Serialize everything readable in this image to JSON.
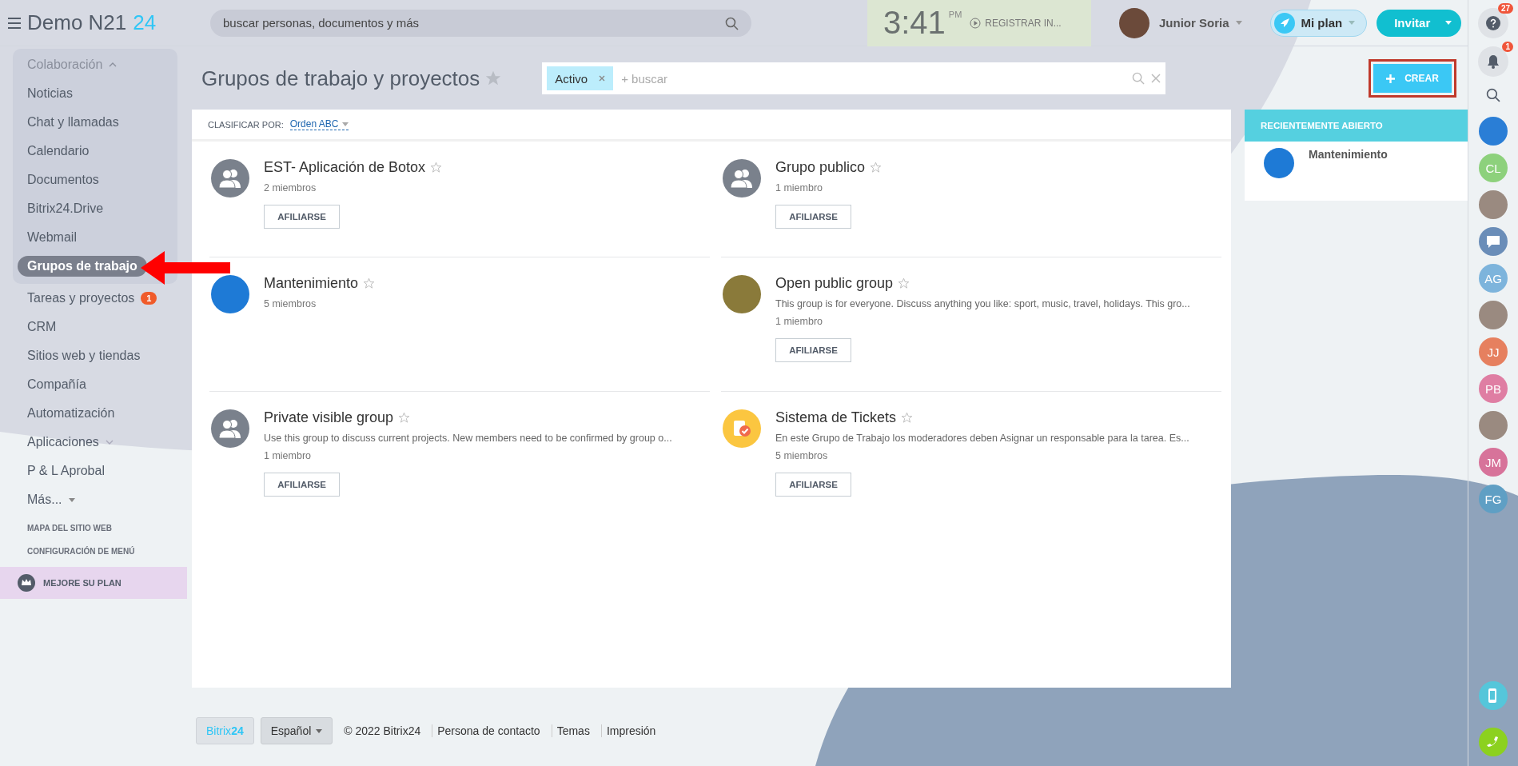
{
  "logo": {
    "name": "Demo N21",
    "suffix": "24"
  },
  "search": {
    "placeholder": "buscar personas, documentos y más"
  },
  "clock": {
    "time": "3:41",
    "period": "PM",
    "action": "REGISTRAR IN..."
  },
  "user": {
    "name": "Junior Soria"
  },
  "plan_button": "Mi plan",
  "invite_button": "Invitar",
  "sidebar": {
    "group": {
      "label": "Colaboración",
      "expanded": true,
      "items": [
        {
          "label": "Noticias",
          "selected": false
        },
        {
          "label": "Chat y llamadas",
          "selected": false
        },
        {
          "label": "Calendario",
          "selected": false
        },
        {
          "label": "Documentos",
          "selected": false
        },
        {
          "label": "Bitrix24.Drive",
          "selected": false
        },
        {
          "label": "Webmail",
          "selected": false
        },
        {
          "label": "Grupos de trabajo",
          "selected": true
        }
      ]
    },
    "items": [
      {
        "label": "Tareas y proyectos",
        "kind": "link",
        "badge": "1"
      },
      {
        "label": "CRM",
        "kind": "link"
      },
      {
        "label": "Sitios web y tiendas",
        "kind": "link"
      },
      {
        "label": "Compañía",
        "kind": "link"
      },
      {
        "label": "Automatización",
        "kind": "link"
      },
      {
        "label": "Aplicaciones",
        "kind": "expandable"
      },
      {
        "label": "P & L Aprobal",
        "kind": "link"
      },
      {
        "label": "Más...",
        "kind": "more"
      }
    ],
    "links": [
      "MAPA DEL SITIO WEB",
      "CONFIGURACIÓN DE MENÚ"
    ],
    "upgrade": "MEJORE SU PLAN"
  },
  "page": {
    "title": "Grupos de trabajo y proyectos",
    "filter_tag": "Activo",
    "filter_placeholder": "+ buscar",
    "create_button": "CREAR",
    "create_highlighted": true
  },
  "sort": {
    "label": "CLASIFICAR POR:",
    "value": "Orden ABC"
  },
  "groups": [
    {
      "title": "EST- Aplicación de Botox",
      "kind": "people",
      "members": "2 miembros",
      "button": "AFILIARSE"
    },
    {
      "title": "Grupo publico",
      "kind": "people",
      "members": "1 miembro",
      "button": "AFILIARSE"
    },
    {
      "title": "Mantenimiento",
      "kind": "picture",
      "members": "5 miembros"
    },
    {
      "title": "Open public group",
      "kind": "photo",
      "description": "This group is for everyone. Discuss anything you like: sport, music, travel, holidays. This gro...",
      "members": "1 miembro",
      "button": "AFILIARSE"
    },
    {
      "title": "Private visible group",
      "kind": "people",
      "description": "Use this group to discuss current projects. New members need to be confirmed by group o...",
      "members": "1 miembro",
      "button": "AFILIARSE"
    },
    {
      "title": "Sistema de Tickets",
      "kind": "tickets",
      "description": "En este Grupo de Trabajo los moderadores deben Asignar un responsable para la tarea. Es...",
      "members": "5 miembros",
      "button": "AFILIARSE"
    }
  ],
  "recent": {
    "title": "RECIENTEMENTE ABIERTO",
    "items": [
      {
        "title": "Mantenimiento"
      }
    ]
  },
  "right_bar": {
    "help_badge": "27",
    "notifications_badge": "1",
    "contacts": [
      {
        "kind": "picture"
      },
      {
        "kind": "initials",
        "text": "CL",
        "color": "#8dd17c"
      },
      {
        "kind": "person"
      },
      {
        "kind": "chat"
      },
      {
        "kind": "initials",
        "text": "AG",
        "color": "#7db4dc"
      },
      {
        "kind": "person"
      },
      {
        "kind": "initials",
        "text": "JJ",
        "color": "#e6805f"
      },
      {
        "kind": "initials",
        "text": "PB",
        "color": "#df7ea3"
      },
      {
        "kind": "person"
      },
      {
        "kind": "initials",
        "text": "JM",
        "color": "#d7739a"
      },
      {
        "kind": "initials",
        "text": "FG",
        "color": "#5f9fc4"
      }
    ]
  },
  "footer": {
    "brand": "Bitrix**24**",
    "language": "Español",
    "copyright": "© 2022 Bitrix24",
    "links": [
      "Persona de contacto",
      "Temas",
      "Impresión"
    ]
  }
}
